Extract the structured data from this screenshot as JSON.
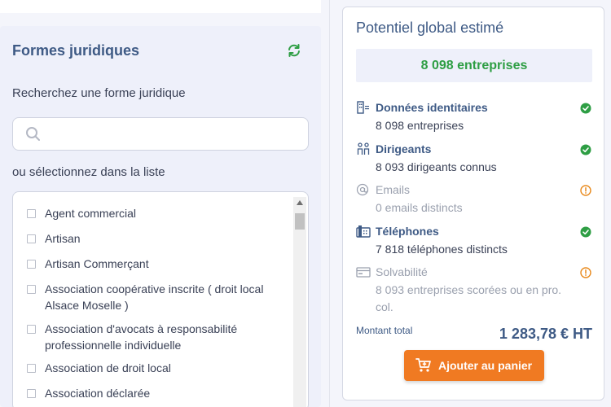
{
  "filters": {
    "title": "Formes juridiques",
    "refresh_icon": "refresh-icon",
    "search_label": "Recherchez une forme juridique",
    "search_value": "",
    "search_placeholder": "",
    "list_label": "ou sélectionnez dans la liste",
    "items": [
      {
        "label": "Agent commercial",
        "checked": false
      },
      {
        "label": "Artisan",
        "checked": false
      },
      {
        "label": "Artisan Commerçant",
        "checked": false
      },
      {
        "label": "Association coopérative inscrite ( droit local Alsace Moselle )",
        "checked": false
      },
      {
        "label": "Association d'avocats à responsabilité professionnelle individuelle",
        "checked": false
      },
      {
        "label": "Association de droit local",
        "checked": false
      },
      {
        "label": "Association déclarée",
        "checked": false
      }
    ]
  },
  "summary": {
    "title": "Potentiel global estimé",
    "count": "8 098 entreprises",
    "items": [
      {
        "icon": "building-icon",
        "title": "Données identitaires",
        "detail": "8 098 entreprises",
        "status": "ok"
      },
      {
        "icon": "people-icon",
        "title": "Dirigeants",
        "detail": "8 093 dirigeants connus",
        "status": "ok"
      },
      {
        "icon": "at-icon",
        "title": "Emails",
        "detail": "0 emails distincts",
        "status": "warning"
      },
      {
        "icon": "phone-icon",
        "title": "Téléphones",
        "detail": "7 818 téléphones distincts",
        "status": "ok"
      },
      {
        "icon": "card-icon",
        "title": "Solvabilité",
        "detail": "8 093 entreprises scorées ou en pro. col.",
        "status": "warning"
      }
    ],
    "total_label": "Montant total",
    "total_value": "1 283,78 € HT",
    "add_button": "Ajouter au panier",
    "colors": {
      "accent": "#3e5a85",
      "success": "#2e9e44",
      "warning": "#e8891c",
      "button": "#f07a22"
    }
  }
}
